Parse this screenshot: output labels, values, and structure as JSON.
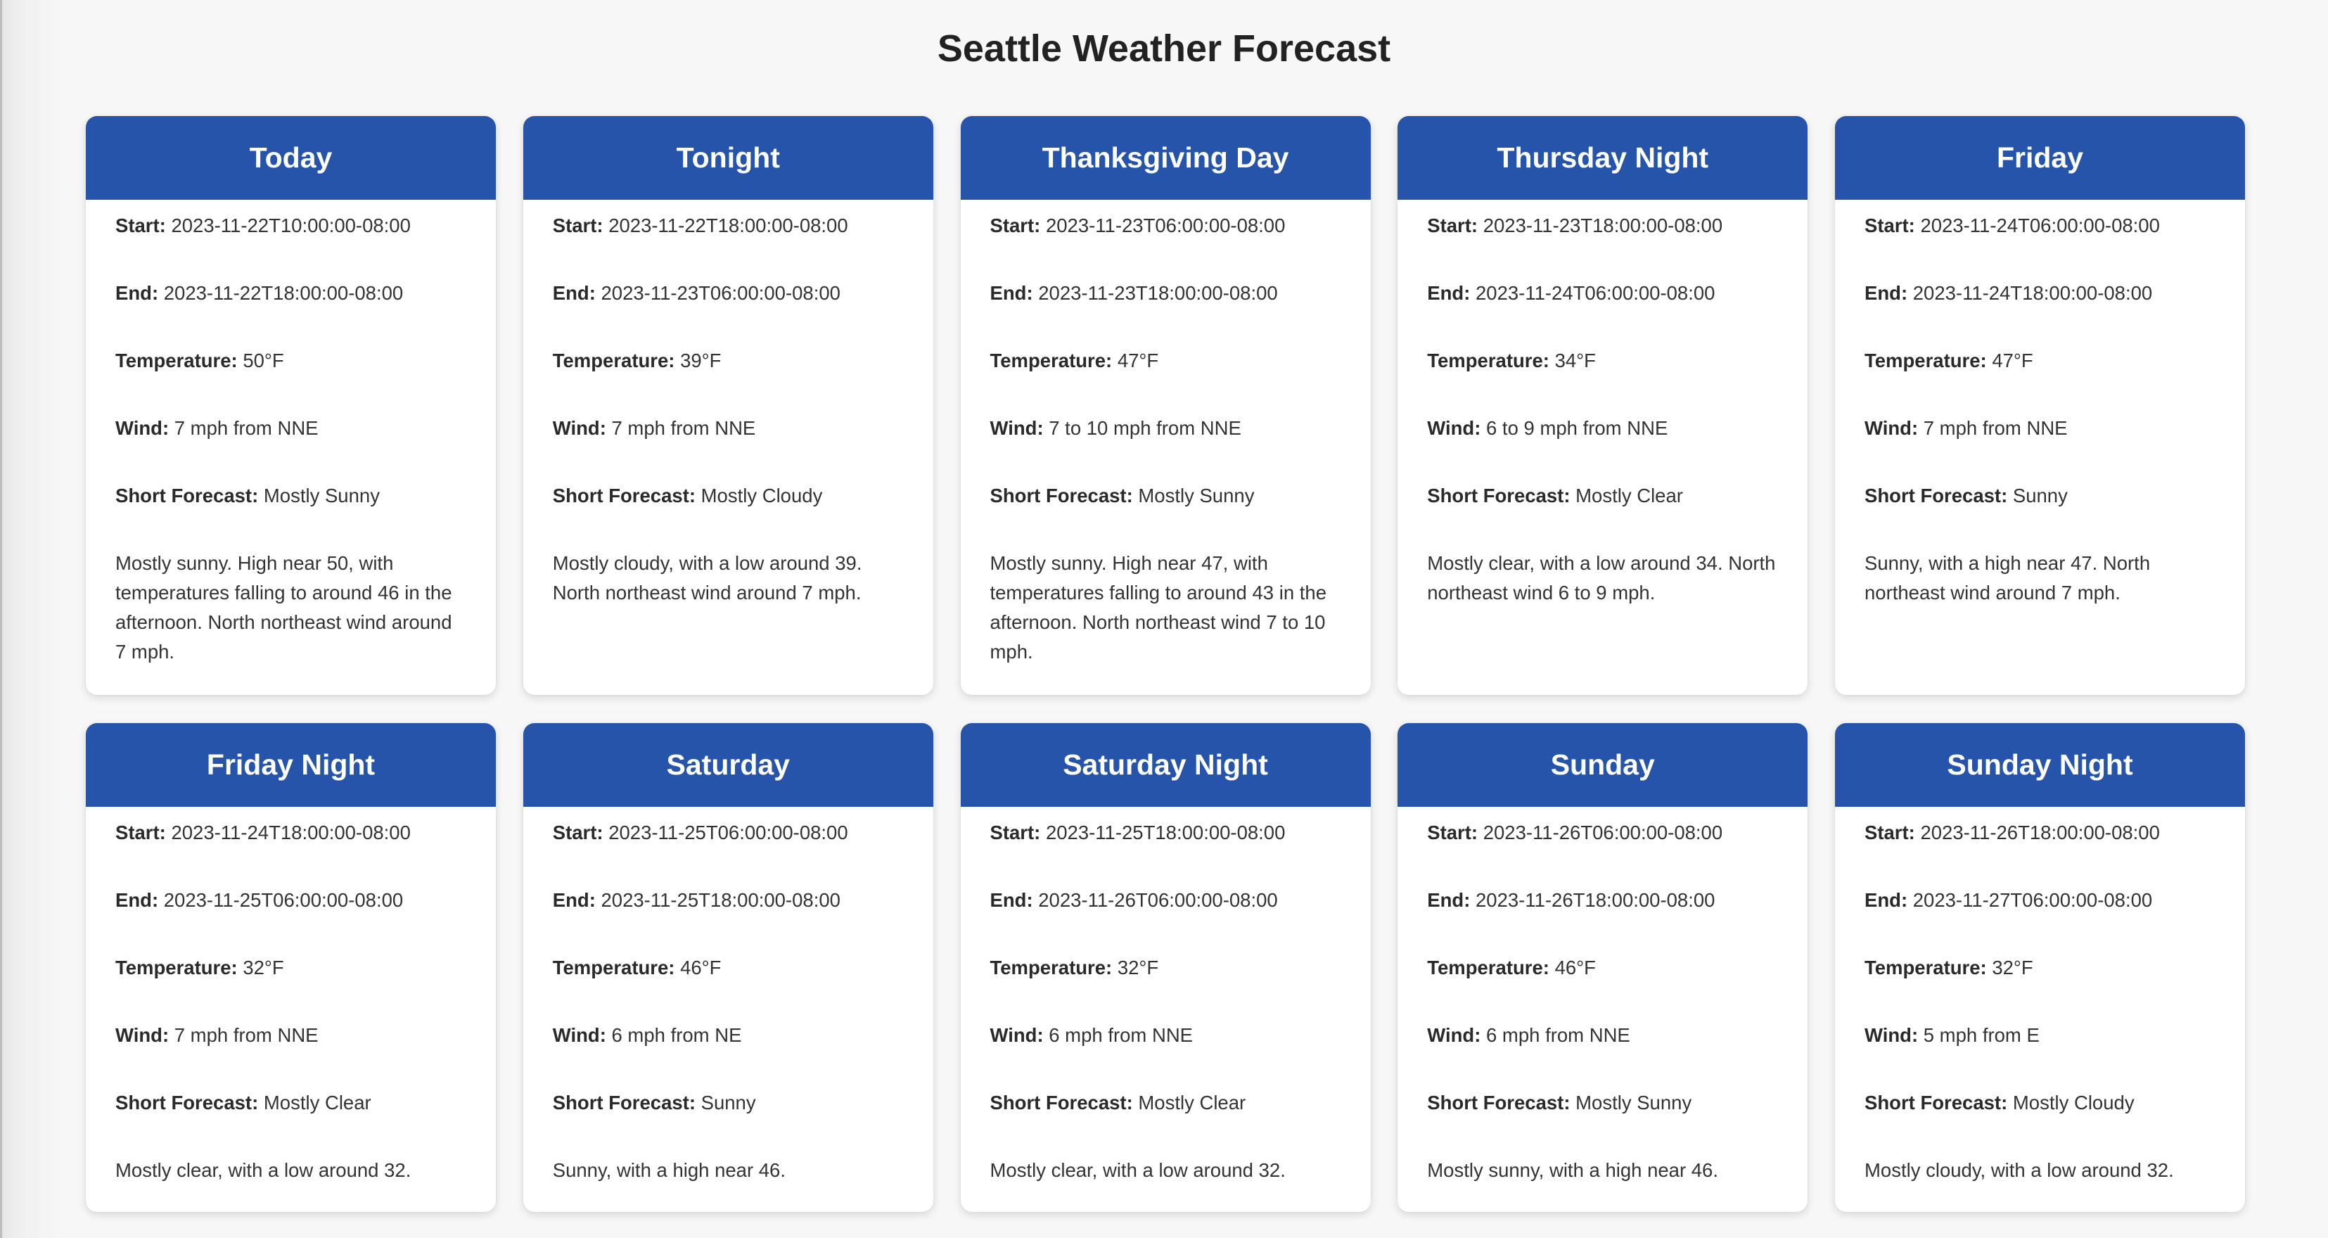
{
  "page": {
    "title": "Seattle Weather Forecast",
    "header_color": "#2554aa"
  },
  "labels": {
    "start": "Start:",
    "end": "End:",
    "temperature": "Temperature:",
    "wind": "Wind:",
    "short_forecast": "Short Forecast:"
  },
  "periods": [
    {
      "name": "Today",
      "start": "2023-11-22T10:00:00-08:00",
      "end": "2023-11-22T18:00:00-08:00",
      "temperature": "50°F",
      "wind": "7 mph from NNE",
      "short_forecast": "Mostly Sunny",
      "detailed_forecast": "Mostly sunny. High near 50, with temperatures falling to around 46 in the afternoon. North northeast wind around 7 mph."
    },
    {
      "name": "Tonight",
      "start": "2023-11-22T18:00:00-08:00",
      "end": "2023-11-23T06:00:00-08:00",
      "temperature": "39°F",
      "wind": "7 mph from NNE",
      "short_forecast": "Mostly Cloudy",
      "detailed_forecast": "Mostly cloudy, with a low around 39. North northeast wind around 7 mph."
    },
    {
      "name": "Thanksgiving Day",
      "start": "2023-11-23T06:00:00-08:00",
      "end": "2023-11-23T18:00:00-08:00",
      "temperature": "47°F",
      "wind": "7 to 10 mph from NNE",
      "short_forecast": "Mostly Sunny",
      "detailed_forecast": "Mostly sunny. High near 47, with temperatures falling to around 43 in the afternoon. North northeast wind 7 to 10 mph."
    },
    {
      "name": "Thursday Night",
      "start": "2023-11-23T18:00:00-08:00",
      "end": "2023-11-24T06:00:00-08:00",
      "temperature": "34°F",
      "wind": "6 to 9 mph from NNE",
      "short_forecast": "Mostly Clear",
      "detailed_forecast": "Mostly clear, with a low around 34. North northeast wind 6 to 9 mph."
    },
    {
      "name": "Friday",
      "start": "2023-11-24T06:00:00-08:00",
      "end": "2023-11-24T18:00:00-08:00",
      "temperature": "47°F",
      "wind": "7 mph from NNE",
      "short_forecast": "Sunny",
      "detailed_forecast": "Sunny, with a high near 47. North northeast wind around 7 mph."
    },
    {
      "name": "Friday Night",
      "start": "2023-11-24T18:00:00-08:00",
      "end": "2023-11-25T06:00:00-08:00",
      "temperature": "32°F",
      "wind": "7 mph from NNE",
      "short_forecast": "Mostly Clear",
      "detailed_forecast": "Mostly clear, with a low around 32."
    },
    {
      "name": "Saturday",
      "start": "2023-11-25T06:00:00-08:00",
      "end": "2023-11-25T18:00:00-08:00",
      "temperature": "46°F",
      "wind": "6 mph from NE",
      "short_forecast": "Sunny",
      "detailed_forecast": "Sunny, with a high near 46."
    },
    {
      "name": "Saturday Night",
      "start": "2023-11-25T18:00:00-08:00",
      "end": "2023-11-26T06:00:00-08:00",
      "temperature": "32°F",
      "wind": "6 mph from NNE",
      "short_forecast": "Mostly Clear",
      "detailed_forecast": "Mostly clear, with a low around 32."
    },
    {
      "name": "Sunday",
      "start": "2023-11-26T06:00:00-08:00",
      "end": "2023-11-26T18:00:00-08:00",
      "temperature": "46°F",
      "wind": "6 mph from NNE",
      "short_forecast": "Mostly Sunny",
      "detailed_forecast": "Mostly sunny, with a high near 46."
    },
    {
      "name": "Sunday Night",
      "start": "2023-11-26T18:00:00-08:00",
      "end": "2023-11-27T06:00:00-08:00",
      "temperature": "32°F",
      "wind": "5 mph from E",
      "short_forecast": "Mostly Cloudy",
      "detailed_forecast": "Mostly cloudy, with a low around 32."
    }
  ]
}
